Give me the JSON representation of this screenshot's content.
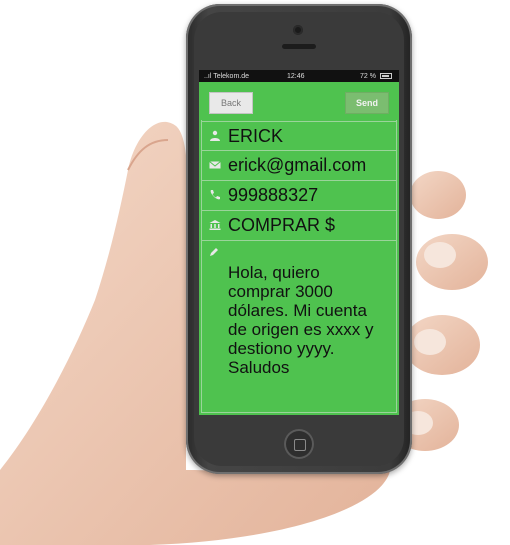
{
  "statusbar": {
    "carrier": "..ıl Telekom.de",
    "time": "12:46",
    "battery": "72 %"
  },
  "nav": {
    "back_label": "Back",
    "send_label": "Send"
  },
  "form": {
    "name": "ERICK",
    "email": "erick@gmail.com",
    "phone": "999888327",
    "subject": "COMPRAR $",
    "message": "Hola, quiero comprar 3000 dólares. Mi cuenta de origen es xxxx y destiono yyyy. Saludos"
  },
  "colors": {
    "screen": "#4fc24f",
    "phone_body": "#3a3a3a"
  },
  "icons": [
    "user-icon",
    "envelope-icon",
    "phone-icon",
    "bank-icon",
    "pencil-icon"
  ]
}
